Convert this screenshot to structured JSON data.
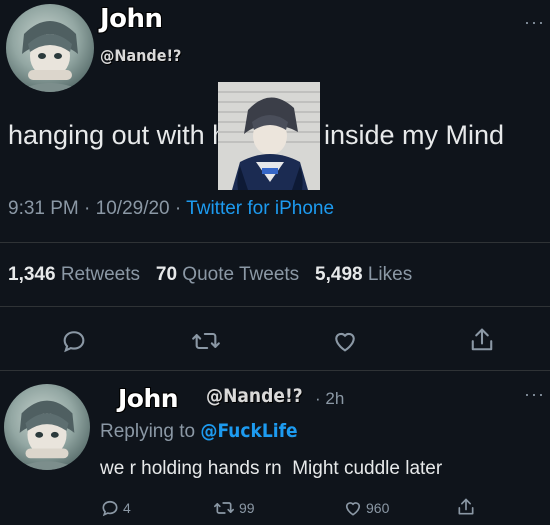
{
  "tweet": {
    "author_name": "John",
    "author_handle": "@Nande!?",
    "text_part1": "hanging out with him",
    "text_part2": "inside my Mind",
    "time": "9:31 PM",
    "sep1": "·",
    "date": "10/29/20",
    "sep2": "·",
    "source": "Twitter for iPhone",
    "stats": {
      "retweets_count": "1,346",
      "retweets_label": "Retweets",
      "quotes_count": "70",
      "quotes_label": "Quote Tweets",
      "likes_count": "5,498",
      "likes_label": "Likes"
    },
    "more": "···"
  },
  "reply": {
    "author_name": "John",
    "author_handle": "@Nande!?",
    "age": "· 2h",
    "replying_label": "Replying to",
    "replying_to": "@FuckLife",
    "text": "we r holding hands rn  Might cuddle later",
    "reply_count": "4",
    "retweet_count": "99",
    "like_count": "960",
    "more": "···"
  },
  "icons": [
    "reply-icon",
    "retweet-icon",
    "like-icon",
    "share-icon"
  ],
  "colors": {
    "background": "#0f141b",
    "link": "#1d9bf0",
    "muted": "#8b98a5"
  }
}
